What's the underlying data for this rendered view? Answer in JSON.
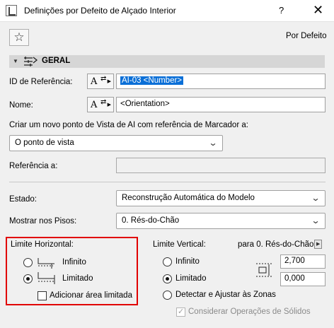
{
  "window": {
    "title": "Definições por Defeito de Alçado Interior",
    "help": "?",
    "close": "✕"
  },
  "toolbar": {
    "favorites_icon": "star-icon",
    "defaults_label": "Por Defeito"
  },
  "section": {
    "title": "GERAL"
  },
  "reference_id": {
    "label": "ID de Referência:",
    "value": "AI-03 <Number>"
  },
  "name": {
    "label": "Nome:",
    "value": "<Orientation>"
  },
  "marker_source": {
    "label": "Criar um novo ponto de Vista de AI com referência de Marcador a:",
    "selected": "O ponto de vista"
  },
  "reference_to": {
    "label": "Referência a:",
    "value": ""
  },
  "status": {
    "label": "Estado:",
    "selected": "Reconstrução Automática do Modelo"
  },
  "show_on_stories": {
    "label": "Mostrar nos Pisos:",
    "selected": "0. Rés-do-Chão"
  },
  "horizontal_limit": {
    "title": "Limite Horizontal:",
    "infinite": "Infinito",
    "limited": "Limitado",
    "selected": "limited",
    "add_area": "Adicionar área limitada",
    "add_area_checked": false
  },
  "vertical_limit": {
    "title": "Limite Vertical:",
    "story_ref": "para 0. Rés-do-Chão",
    "infinite": "Infinito",
    "limited": "Limitado",
    "detect": "Detectar e Ajustar às Zonas",
    "selected": "limited",
    "top_value": "2,700",
    "bottom_value": "0,000",
    "consider_solids": "Considerar Operações de Sólidos",
    "consider_solids_checked": true,
    "consider_solids_disabled": true
  }
}
